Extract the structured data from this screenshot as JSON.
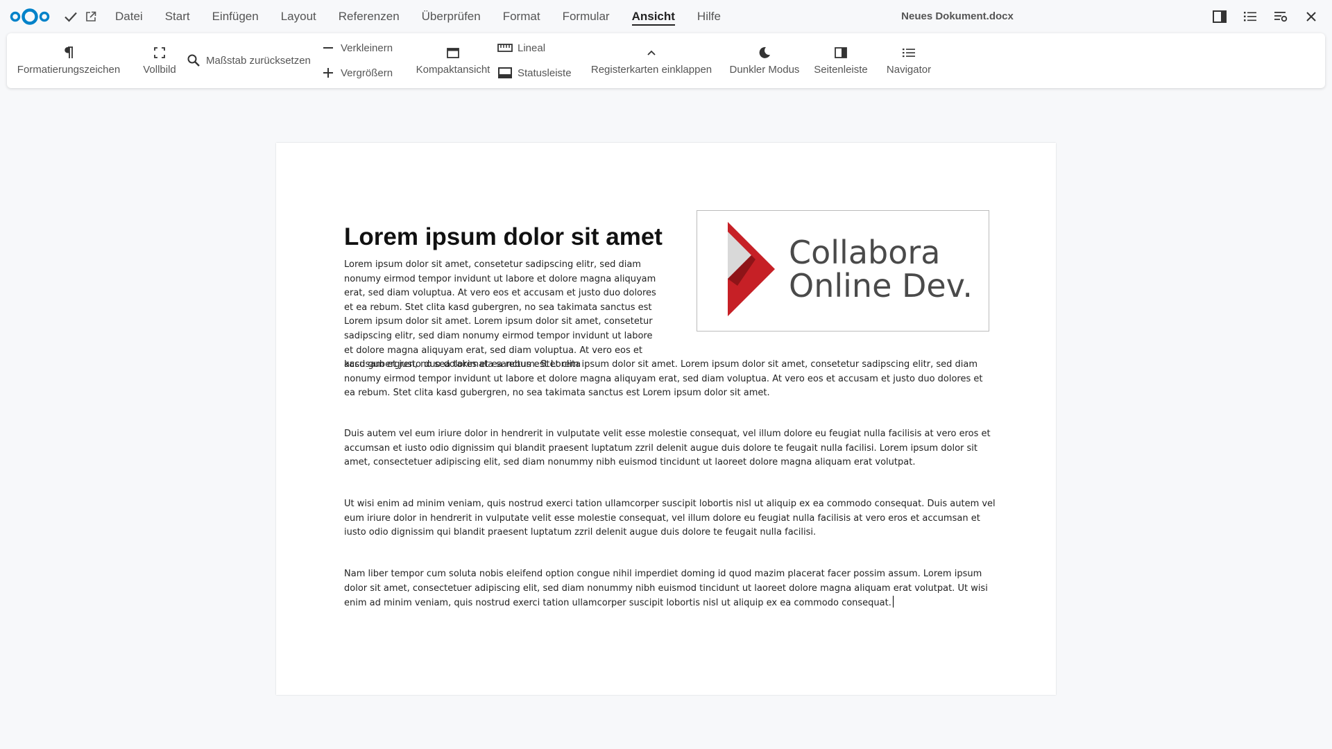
{
  "menu": {
    "items": [
      "Datei",
      "Start",
      "Einfügen",
      "Layout",
      "Referenzen",
      "Überprüfen",
      "Format",
      "Formular",
      "Ansicht",
      "Hilfe"
    ],
    "active": "Ansicht"
  },
  "document": {
    "filename": "Neues Dokument.docx",
    "heading": "Lorem ipsum dolor sit amet",
    "paragraphs": [
      "Lorem ipsum dolor sit amet, consetetur sadipscing elitr, sed diam nonumy eirmod tempor invidunt ut labore et dolore magna aliquyam erat, sed diam voluptua. At vero eos et accusam et justo duo dolores et ea rebum. Stet clita kasd gubergren, no sea takimata sanctus est Lorem ipsum dolor sit amet. Lorem ipsum dolor sit amet, consetetur sadipscing elitr, sed diam nonumy eirmod tempor invidunt ut labore et dolore magna aliquyam erat, sed diam voluptua. At vero eos et accusam et justo duo dolores et ea rebum. Stet clita",
      "kasd gubergren, no sea takimata sanctus est Lorem ipsum dolor sit amet. Lorem ipsum dolor sit amet, consetetur sadipscing elitr, sed diam nonumy eirmod tempor invidunt ut labore et dolore magna aliquyam erat, sed diam voluptua. At vero eos et accusam et justo duo dolores et ea rebum. Stet clita kasd gubergren, no sea takimata sanctus est Lorem ipsum dolor sit amet.",
      "Duis autem vel eum iriure dolor in hendrerit in vulputate velit esse molestie consequat, vel illum dolore eu feugiat nulla facilisis at vero eros et accumsan et iusto odio dignissim qui blandit praesent luptatum zzril delenit augue duis dolore te feugait nulla facilisi. Lorem ipsum dolor sit amet, consectetuer adipiscing elit, sed diam nonummy nibh euismod tincidunt ut laoreet dolore magna aliquam erat volutpat.",
      "Ut wisi enim ad minim veniam, quis nostrud exerci tation ullamcorper suscipit lobortis nisl ut aliquip ex ea commodo consequat. Duis autem vel eum iriure dolor in hendrerit in vulputate velit esse molestie consequat, vel illum dolore eu feugiat nulla facilisis at vero eros et accumsan et iusto odio dignissim qui blandit praesent luptatum zzril delenit augue duis dolore te feugait nulla facilisi.",
      "Nam liber tempor cum soluta nobis eleifend option congue nihil imperdiet doming id quod mazim placerat facer possim assum. Lorem ipsum dolor sit amet, consectetuer adipiscing elit, sed diam nonummy nibh euismod tincidunt ut laoreet dolore magna aliquam erat volutpat. Ut wisi enim ad minim veniam, quis nostrud exerci tation ullamcorper suscipit lobortis nisl ut aliquip ex ea commodo consequat."
    ],
    "logo_line1": "Collabora",
    "logo_line2": "Online Dev."
  },
  "toolbar": {
    "formatting_marks": "Formatierungszeichen",
    "fullscreen": "Vollbild",
    "reset_zoom": "Maßstab zurücksetzen",
    "zoom_out": "Verkleinern",
    "zoom_in": "Vergrößern",
    "compact_view": "Kompaktansicht",
    "ruler": "Lineal",
    "statusbar": "Statusleiste",
    "collapse_tabs": "Registerkarten einklappen",
    "dark_mode": "Dunkler Modus",
    "sidebar": "Seitenleiste",
    "navigator": "Navigator"
  },
  "colors": {
    "nextcloud_blue": "#0082c9",
    "logo_red": "#c62026",
    "logo_gray": "#4a4a4a"
  }
}
